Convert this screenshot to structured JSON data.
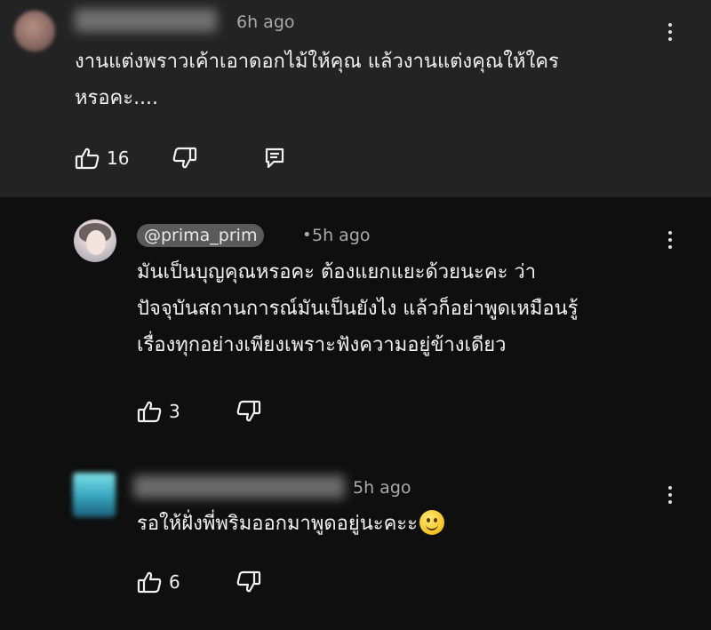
{
  "comments": [
    {
      "time": "6h ago",
      "text_lines": [
        "งานแต่งพราวเค้าเอาดอกไม้ให้คุณ แล้วงานแต่งคุณให้ใคร",
        "หรอคะ...."
      ],
      "likes": "16",
      "icons": [
        "thumbs-up-icon",
        "thumbs-down-icon",
        "reply-icon",
        "more-vert-icon"
      ]
    },
    {
      "handle": "@prima_prim",
      "separator": "•",
      "time": "5h ago",
      "text_lines": [
        "มันเป็นบุญคุณหรอคะ ต้องแยกแยะด้วยนะคะ ว่า",
        "ปัจจุบันสถานการณ์มันเป็นยังไง แล้วก็อย่าพูดเหมือนรู้",
        "เรื่องทุกอย่างเพียงเพราะฟังความอยู่ข้างเดียว"
      ],
      "likes": "3",
      "icons": [
        "thumbs-up-icon",
        "thumbs-down-icon",
        "more-vert-icon"
      ]
    },
    {
      "time": "5h ago",
      "text": "รอให้ฝั่งพี่พริมออกมาพูดอยู่นะคะะ",
      "emoji": "smiling-face-icon",
      "likes": "6",
      "icons": [
        "thumbs-up-icon",
        "thumbs-down-icon",
        "more-vert-icon"
      ]
    }
  ],
  "colors": {
    "top_background": "#232323",
    "page_background": "#0f0f0f",
    "text": "#f1f1f1",
    "meta_text": "#aaaaaa",
    "handle_chip": "#5a5a5a"
  }
}
